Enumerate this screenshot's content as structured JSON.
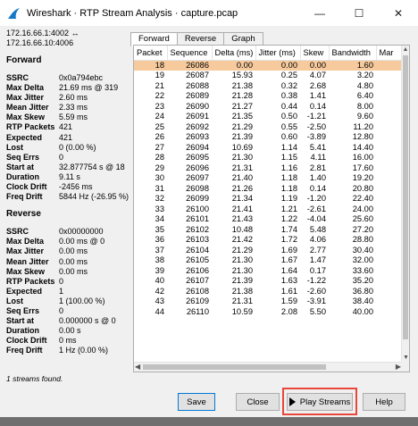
{
  "window": {
    "title": "Wireshark · RTP Stream Analysis · capture.pcap",
    "minimize_glyph": "—",
    "maximize_glyph": "☐",
    "close_glyph": "✕"
  },
  "endpoints": {
    "line1": "172.16.66.1:4002 ↔",
    "line2": "172.16.66.10:4006"
  },
  "forward": {
    "heading": "Forward",
    "stats": [
      {
        "label": "SSRC",
        "value": "0x0a794ebc"
      },
      {
        "label": "Max Delta",
        "value": "21.69 ms @ 319"
      },
      {
        "label": "Max Jitter",
        "value": "2.60 ms"
      },
      {
        "label": "Mean Jitter",
        "value": "2.33 ms"
      },
      {
        "label": "Max Skew",
        "value": "5.59 ms"
      },
      {
        "label": "RTP Packets",
        "value": "421"
      },
      {
        "label": "Expected",
        "value": "421"
      },
      {
        "label": "Lost",
        "value": "0 (0.00 %)"
      },
      {
        "label": "Seq Errs",
        "value": "0"
      },
      {
        "label": "Start at",
        "value": "32.877754 s @ 18"
      },
      {
        "label": "Duration",
        "value": "9.11 s"
      },
      {
        "label": "Clock Drift",
        "value": "-2456 ms"
      },
      {
        "label": "Freq Drift",
        "value": "5844 Hz (-26.95 %)"
      }
    ]
  },
  "reverse": {
    "heading": "Reverse",
    "stats": [
      {
        "label": "SSRC",
        "value": "0x00000000"
      },
      {
        "label": "Max Delta",
        "value": "0.00 ms @ 0"
      },
      {
        "label": "Max Jitter",
        "value": "0.00 ms"
      },
      {
        "label": "Mean Jitter",
        "value": "0.00 ms"
      },
      {
        "label": "Max Skew",
        "value": "0.00 ms"
      },
      {
        "label": "RTP Packets",
        "value": "0"
      },
      {
        "label": "Expected",
        "value": "1"
      },
      {
        "label": "Lost",
        "value": "1 (100.00 %)"
      },
      {
        "label": "Seq Errs",
        "value": "0"
      },
      {
        "label": "Start at",
        "value": "0.000000 s @ 0"
      },
      {
        "label": "Duration",
        "value": "0.00 s"
      },
      {
        "label": "Clock Drift",
        "value": "0 ms"
      },
      {
        "label": "Freq Drift",
        "value": "1 Hz (0.00 %)"
      }
    ]
  },
  "streams_found": "1 streams found.",
  "tabs": [
    {
      "label": "Forward",
      "active": true
    },
    {
      "label": "Reverse",
      "active": false
    },
    {
      "label": "Graph",
      "active": false
    }
  ],
  "table": {
    "columns": [
      "Packet",
      "Sequence",
      "Delta (ms)",
      "Jitter (ms)",
      "Skew",
      "Bandwidth",
      "Mar"
    ],
    "selected_row": 0,
    "rows": [
      [
        "18",
        "26086",
        "0.00",
        "0.00",
        "0.00",
        "1.60"
      ],
      [
        "19",
        "26087",
        "15.93",
        "0.25",
        "4.07",
        "3.20"
      ],
      [
        "21",
        "26088",
        "21.38",
        "0.32",
        "2.68",
        "4.80"
      ],
      [
        "22",
        "26089",
        "21.28",
        "0.38",
        "1.41",
        "6.40"
      ],
      [
        "23",
        "26090",
        "21.27",
        "0.44",
        "0.14",
        "8.00"
      ],
      [
        "24",
        "26091",
        "21.35",
        "0.50",
        "-1.21",
        "9.60"
      ],
      [
        "25",
        "26092",
        "21.29",
        "0.55",
        "-2.50",
        "11.20"
      ],
      [
        "26",
        "26093",
        "21.39",
        "0.60",
        "-3.89",
        "12.80"
      ],
      [
        "27",
        "26094",
        "10.69",
        "1.14",
        "5.41",
        "14.40"
      ],
      [
        "28",
        "26095",
        "21.30",
        "1.15",
        "4.11",
        "16.00"
      ],
      [
        "29",
        "26096",
        "21.31",
        "1.16",
        "2.81",
        "17.60"
      ],
      [
        "30",
        "26097",
        "21.40",
        "1.18",
        "1.40",
        "19.20"
      ],
      [
        "31",
        "26098",
        "21.26",
        "1.18",
        "0.14",
        "20.80"
      ],
      [
        "32",
        "26099",
        "21.34",
        "1.19",
        "-1.20",
        "22.40"
      ],
      [
        "33",
        "26100",
        "21.41",
        "1.21",
        "-2.61",
        "24.00"
      ],
      [
        "34",
        "26101",
        "21.43",
        "1.22",
        "-4.04",
        "25.60"
      ],
      [
        "35",
        "26102",
        "10.48",
        "1.74",
        "5.48",
        "27.20"
      ],
      [
        "36",
        "26103",
        "21.42",
        "1.72",
        "4.06",
        "28.80"
      ],
      [
        "37",
        "26104",
        "21.29",
        "1.69",
        "2.77",
        "30.40"
      ],
      [
        "38",
        "26105",
        "21.30",
        "1.67",
        "1.47",
        "32.00"
      ],
      [
        "39",
        "26106",
        "21.30",
        "1.64",
        "0.17",
        "33.60"
      ],
      [
        "40",
        "26107",
        "21.39",
        "1.63",
        "-1.22",
        "35.20"
      ],
      [
        "42",
        "26108",
        "21.38",
        "1.61",
        "-2.60",
        "36.80"
      ],
      [
        "43",
        "26109",
        "21.31",
        "1.59",
        "-3.91",
        "38.40"
      ],
      [
        "44",
        "26110",
        "10.59",
        "2.08",
        "5.50",
        "40.00"
      ]
    ]
  },
  "buttons": {
    "save": "Save",
    "close": "Close",
    "play_streams": "Play Streams",
    "help": "Help"
  },
  "colors": {
    "selected_row": "#f6ca9d",
    "highlight_box": "#e8473a"
  }
}
